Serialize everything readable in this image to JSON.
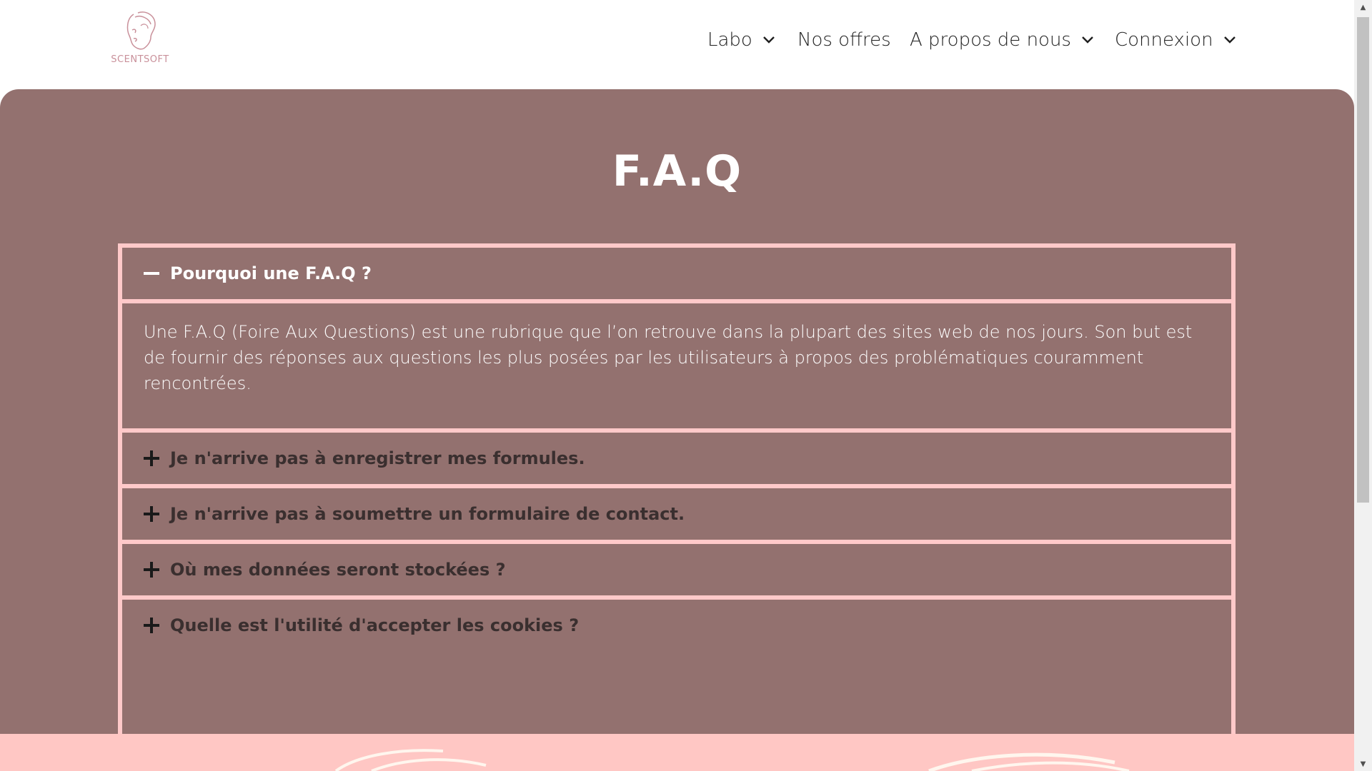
{
  "logo": {
    "text": "SCENTSOFT",
    "icon": "face-line-art-logo"
  },
  "nav": {
    "labo": "Labo",
    "offres": "Nos offres",
    "apropos": "A propos de nous",
    "connexion": "Connexion"
  },
  "faq": {
    "title": "F.A.Q",
    "items": [
      {
        "question": "Pourquoi une F.A.Q ?",
        "open": true,
        "answer": "Une F.A.Q (Foire Aux Questions) est une rubrique que l’on retrouve dans la plupart des sites web de nos jours. Son but est de fournir des réponses aux questions les plus posées par les utilisateurs à propos des problématiques couramment rencontrées."
      },
      {
        "question": "Je n'arrive pas à enregistrer mes formules.",
        "open": false
      },
      {
        "question": "Je n'arrive pas à soumettre un formulaire de contact.",
        "open": false
      },
      {
        "question": "Où mes données seront stockées ?",
        "open": false
      },
      {
        "question": "Quelle est l'utilité d'accepter les cookies ?",
        "open": false
      }
    ]
  },
  "colors": {
    "section_bg": "#93716f",
    "accent_pink": "#ffc9c9",
    "bottom_band": "#ffc7c4",
    "logo_pink": "#c9909a"
  },
  "icons": {
    "minus": "minus-icon",
    "plus": "plus-icon",
    "chevron": "chevron-down-icon"
  }
}
